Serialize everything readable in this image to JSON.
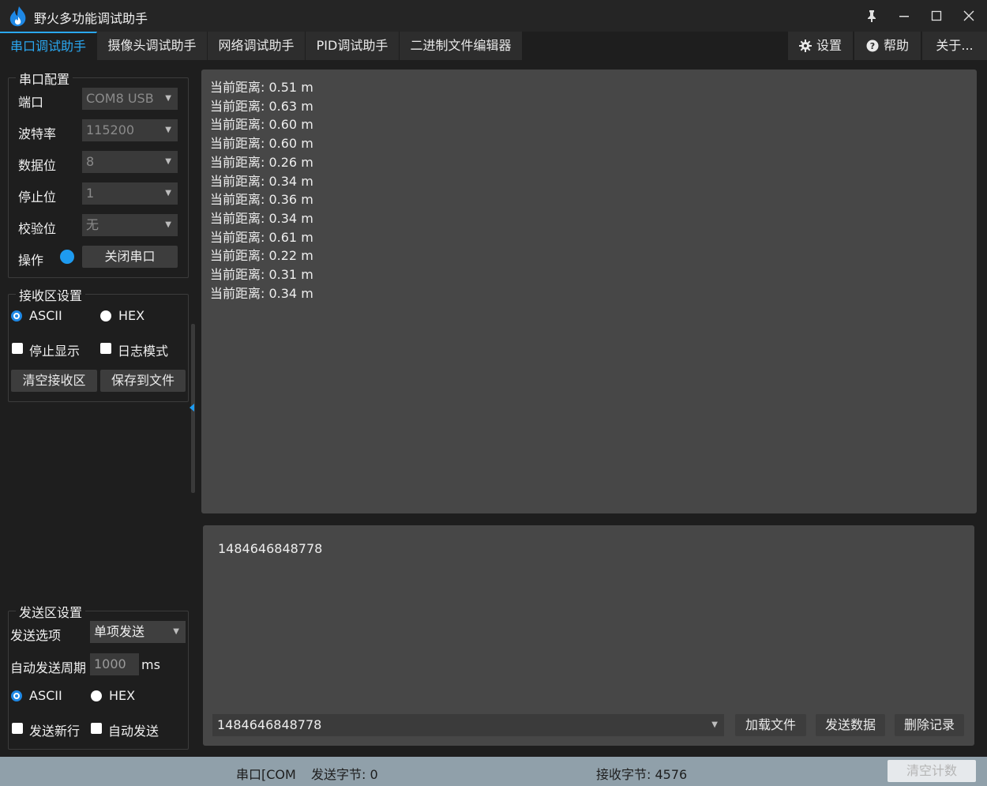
{
  "window": {
    "title": "野火多功能调试助手"
  },
  "tabs": [
    {
      "label": "串口调试助手",
      "active": true
    },
    {
      "label": "摄像头调试助手",
      "active": false
    },
    {
      "label": "网络调试助手",
      "active": false
    },
    {
      "label": "PID调试助手",
      "active": false
    },
    {
      "label": "二进制文件编辑器",
      "active": false
    }
  ],
  "toolbar": {
    "settings_label": "设置",
    "help_label": "帮助",
    "about_label": "关于..."
  },
  "serial_config": {
    "title": "串口配置",
    "port_label": "端口",
    "port_value": "COM8 USB",
    "baud_label": "波特率",
    "baud_value": "115200",
    "databits_label": "数据位",
    "databits_value": "8",
    "stopbits_label": "停止位",
    "stopbits_value": "1",
    "parity_label": "校验位",
    "parity_value": "无",
    "operation_label": "操作",
    "close_port_label": "关闭串口"
  },
  "rx_settings": {
    "title": "接收区设置",
    "ascii_label": "ASCII",
    "hex_label": "HEX",
    "stop_display_label": "停止显示",
    "log_mode_label": "日志模式",
    "clear_label": "清空接收区",
    "save_label": "保存到文件"
  },
  "tx_settings": {
    "title": "发送区设置",
    "option_label": "发送选项",
    "option_value": "单项发送",
    "period_label": "自动发送周期",
    "period_value": "1000",
    "period_unit": "ms",
    "ascii_label": "ASCII",
    "hex_label": "HEX",
    "newline_label": "发送新行",
    "auto_send_label": "自动发送"
  },
  "rx_lines": [
    "当前距离: 0.51 m",
    "当前距离: 0.63 m",
    "当前距离: 0.60 m",
    "当前距离: 0.60 m",
    "当前距离: 0.26 m",
    "当前距离: 0.34 m",
    "当前距离: 0.36 m",
    "当前距离: 0.34 m",
    "当前距离: 0.61 m",
    "当前距离: 0.22 m",
    "当前距离: 0.31 m",
    "当前距离: 0.34 m"
  ],
  "tx_area": {
    "content": "1484646848778",
    "history_value": "1484646848778",
    "load_file_label": "加载文件",
    "send_label": "发送数据",
    "delete_history_label": "删除记录"
  },
  "status": {
    "port": "串口[COM",
    "sent": "发送字节: 0",
    "received": "接收字节: 4576",
    "clear_count_label": "清空计数"
  },
  "colors": {
    "accent": "#2aa7f0",
    "led": "#1e9bf0",
    "status_bar": "#90a0aa"
  }
}
